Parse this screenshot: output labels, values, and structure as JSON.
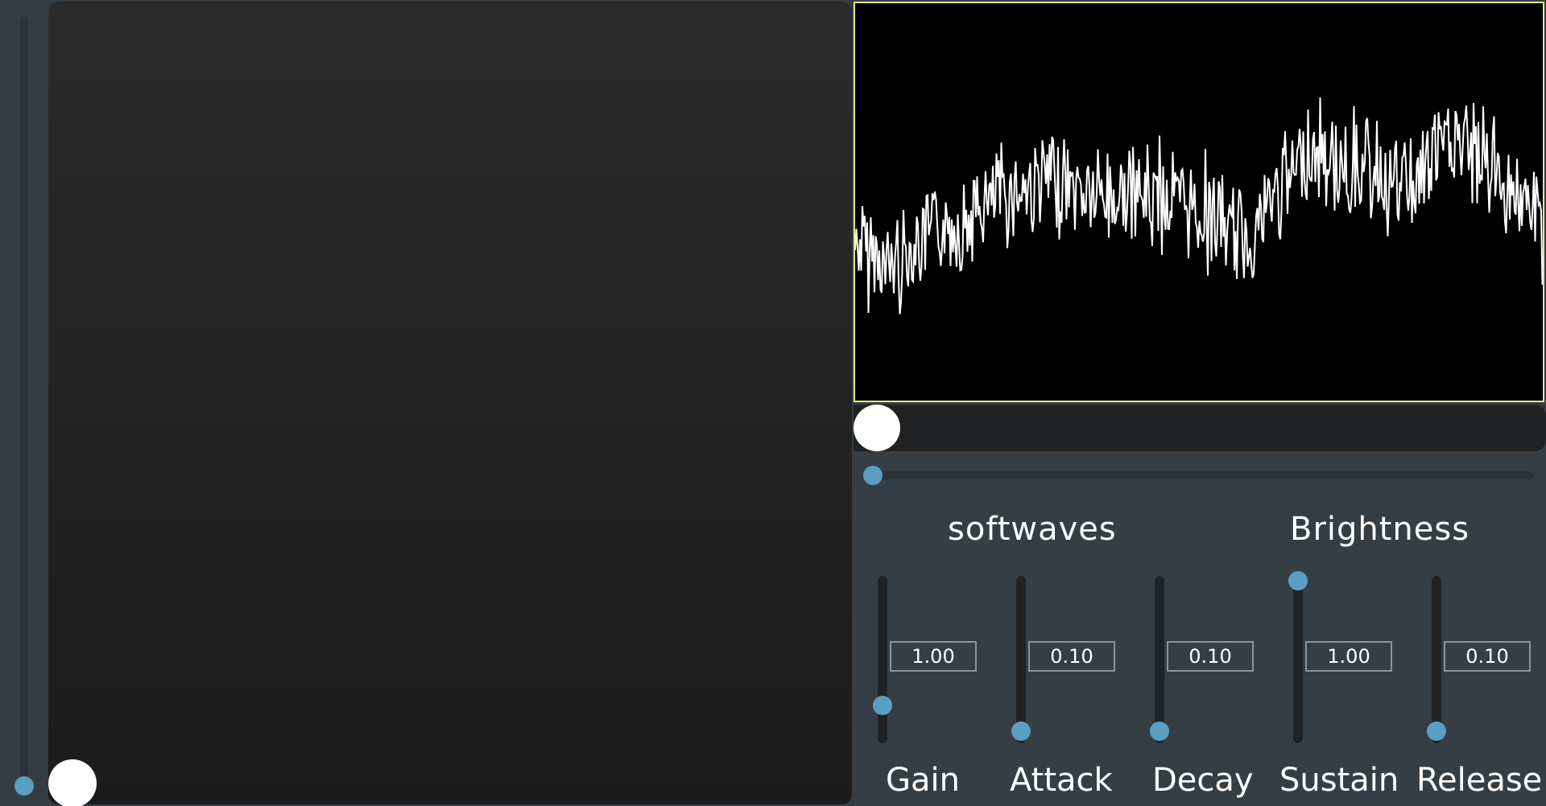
{
  "section_labels": {
    "synth": "softwaves",
    "macro": "Brightness"
  },
  "params": [
    {
      "label": "Gain",
      "value": "1.00",
      "level": 0.22
    },
    {
      "label": "Attack",
      "value": "0.10",
      "level": 0.05
    },
    {
      "label": "Decay",
      "value": "0.10",
      "level": 0.05
    },
    {
      "label": "Sustain",
      "value": "1.00",
      "level": 1.0
    },
    {
      "label": "Release",
      "value": "0.10",
      "level": 0.05
    }
  ],
  "left_slider": {
    "level": 0.0
  },
  "xy_pad": {
    "x": 0.0,
    "y": 0.0
  },
  "position_slider": {
    "level": 0.0
  },
  "scrub_slider": {
    "level": 0.0
  },
  "colors": {
    "background": "#353e45",
    "accent": "#5b9ec3",
    "waveform": "#ffffff",
    "display_border": "#e7e97a"
  }
}
